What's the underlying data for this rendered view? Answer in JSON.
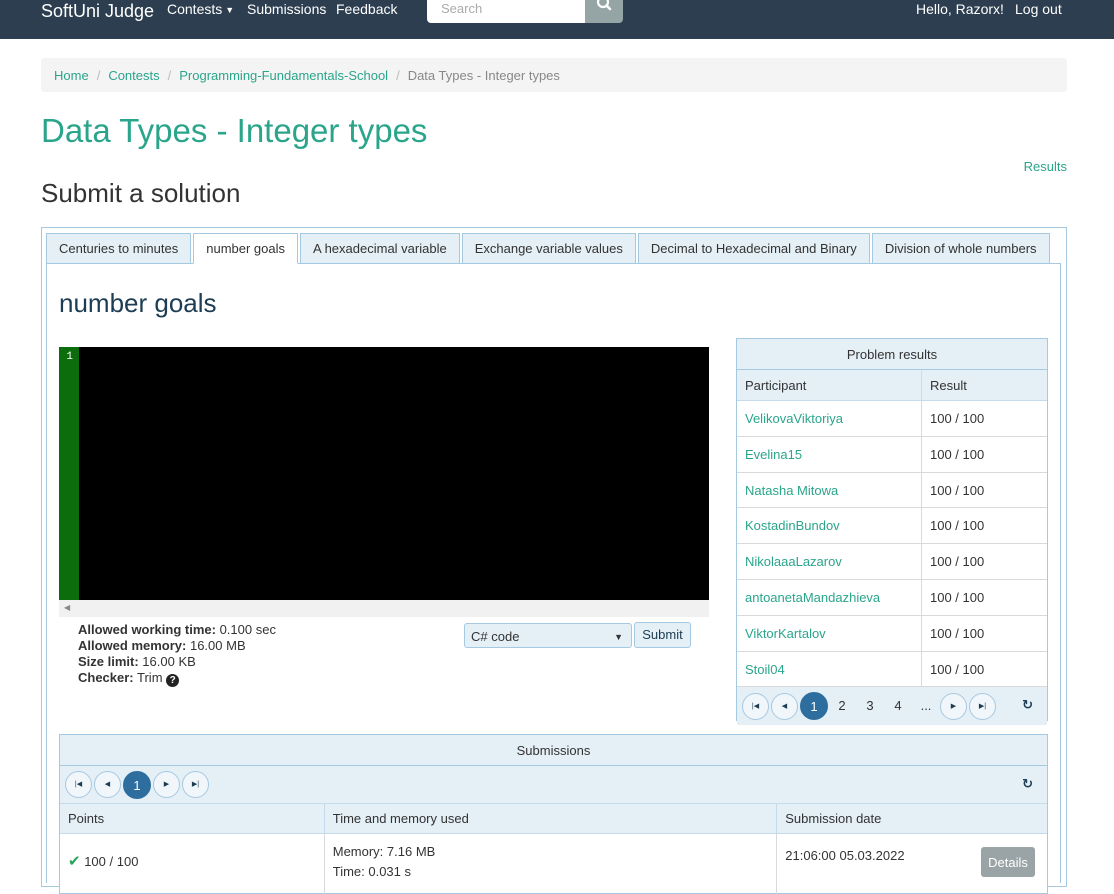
{
  "nav": {
    "brand": "SoftUni Judge",
    "contests": "Contests",
    "submissions": "Submissions",
    "feedback": "Feedback",
    "search_placeholder": "Search",
    "greeting": "Hello, Razorx!",
    "logout": "Log out"
  },
  "breadcrumb": [
    "Home",
    "Contests",
    "Programming-Fundamentals-School",
    "Data Types - Integer types"
  ],
  "page": {
    "title": "Data Types - Integer types",
    "results_link": "Results",
    "subtitle": "Submit a solution"
  },
  "tabs": [
    "Centuries to minutes",
    "number goals",
    "A hexadecimal variable",
    "Exchange variable values",
    "Decimal to Hexadecimal and Binary",
    "Division of whole numbers"
  ],
  "problem": {
    "title": "number goals",
    "editor_line": "1",
    "limits": {
      "time_label": "Allowed working time:",
      "time_value": " 0.100 sec",
      "memory_label": "Allowed memory:",
      "memory_value": " 16.00 MB",
      "size_label": "Size limit:",
      "size_value": " 16.00 KB",
      "checker_label": "Checker:",
      "checker_value": " Trim"
    },
    "language": "C# code",
    "submit": "Submit"
  },
  "results": {
    "title": "Problem results",
    "columns": [
      "Participant",
      "Result"
    ],
    "rows": [
      {
        "participant": "VelikovaViktoriya",
        "result": "100 / 100"
      },
      {
        "participant": "Evelina15",
        "result": "100 / 100"
      },
      {
        "participant": "Natasha Mitowa",
        "result": "100 / 100"
      },
      {
        "participant": "KostadinBundov",
        "result": "100 / 100"
      },
      {
        "participant": "NikolaaaLazarov",
        "result": "100 / 100"
      },
      {
        "participant": "antoanetaMandazhieva",
        "result": "100 / 100"
      },
      {
        "participant": "ViktorKartalov",
        "result": "100 / 100"
      },
      {
        "participant": "Stoil04",
        "result": "100 / 100"
      }
    ],
    "pages": [
      "1",
      "2",
      "3",
      "4",
      "..."
    ]
  },
  "submissions": {
    "title": "Submissions",
    "page": "1",
    "columns": [
      "Points",
      "Time and memory used",
      "Submission date"
    ],
    "rows": [
      {
        "points": "100 / 100",
        "memory": "Memory: 7.16 MB",
        "time": "Time: 0.031 s",
        "date": "21:06:00 05.03.2022",
        "details": "Details"
      }
    ]
  },
  "colors": {
    "accent": "#2aa58b",
    "navbar": "#2c3e50",
    "panel_header": "#e4eff6",
    "border": "#a6c9e2",
    "gutter": "#0b6d0b"
  }
}
